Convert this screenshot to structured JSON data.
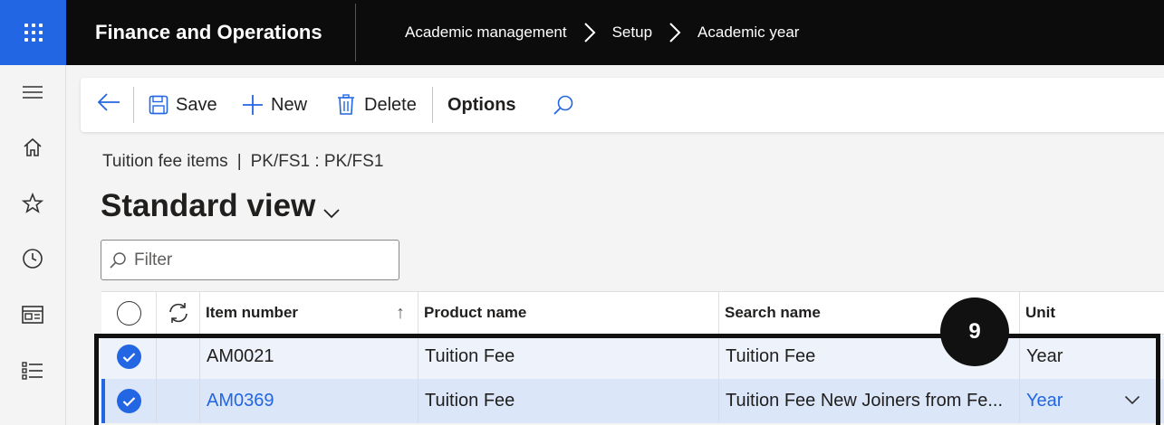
{
  "app": {
    "title": "Finance and Operations",
    "waffle_icon": "waffle-icon",
    "colors": {
      "topbar": "#0c0c0c",
      "waffle": "#2266e3",
      "accent": "#2266e3"
    }
  },
  "breadcrumb": [
    "Academic management",
    "Setup",
    "Academic year"
  ],
  "nav": {
    "items": [
      "hamburger-icon",
      "home-icon",
      "star-icon",
      "clock-icon",
      "workspace-icon",
      "list-icon"
    ]
  },
  "actions": {
    "save": "Save",
    "new": "New",
    "delete": "Delete",
    "options": "Options"
  },
  "page": {
    "caption_left": "Tuition fee items",
    "caption_sep": "|",
    "caption_right": "PK/FS1 : PK/FS1",
    "view_title": "Standard view"
  },
  "filter": {
    "placeholder": "Filter"
  },
  "grid": {
    "columns": [
      "Item number",
      "Product name",
      "Search name",
      "Unit"
    ],
    "sort_indicator": "↑",
    "rows": [
      {
        "item_number": "AM0021",
        "product_name": "Tuition Fee",
        "search_name": "Tuition Fee",
        "unit": "Year",
        "selected": true
      },
      {
        "item_number": "AM0369",
        "product_name": "Tuition Fee",
        "search_name": "Tuition Fee New Joiners from Fe...",
        "unit": "Year",
        "selected": true
      }
    ]
  },
  "step_badge": "9"
}
